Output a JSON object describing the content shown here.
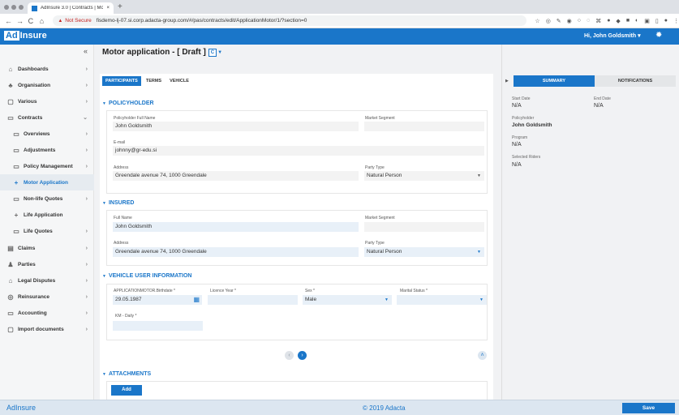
{
  "browser": {
    "tab_title": "AdInsure 3.0 | Contracts | Mo",
    "tab_close": "×",
    "new_tab": "+",
    "not_secure": "Not Secure",
    "url": "fisdemo-lj-07.si.corp.adacta-group.com/#/pas/contracts/edit/ApplicationMotor/1/?section=0"
  },
  "header": {
    "logo_box": "Ad",
    "logo_rest": "Insure",
    "user": "Hi, John Goldsmith ▾"
  },
  "sidebar": {
    "collapse": "«",
    "items": [
      {
        "label": "Dashboards",
        "icon": "dashboard-icon",
        "glyph": "⌂"
      },
      {
        "label": "Organisation",
        "icon": "organisation-icon",
        "glyph": "♣"
      },
      {
        "label": "Various",
        "icon": "various-icon",
        "glyph": "▢"
      },
      {
        "label": "Contracts",
        "icon": "folder-icon",
        "glyph": "▭"
      },
      {
        "label": "Overviews",
        "icon": "folder-icon",
        "glyph": "▭"
      },
      {
        "label": "Adjustments",
        "icon": "folder-icon",
        "glyph": "▭"
      },
      {
        "label": "Policy Management",
        "icon": "folder-icon",
        "glyph": "▭"
      },
      {
        "label": "Motor Application",
        "icon": "plus-icon",
        "glyph": "+"
      },
      {
        "label": "Non-life Quotes",
        "icon": "folder-icon",
        "glyph": "▭"
      },
      {
        "label": "Life Application",
        "icon": "plus-icon",
        "glyph": "+"
      },
      {
        "label": "Life Quotes",
        "icon": "folder-icon",
        "glyph": "▭"
      },
      {
        "label": "Claims",
        "icon": "claims-icon",
        "glyph": "▤"
      },
      {
        "label": "Parties",
        "icon": "parties-icon",
        "glyph": "♟"
      },
      {
        "label": "Legal Disputes",
        "icon": "legal-icon",
        "glyph": "⌂"
      },
      {
        "label": "Reinsurance",
        "icon": "reinsurance-icon",
        "glyph": "◎"
      },
      {
        "label": "Accounting",
        "icon": "accounting-icon",
        "glyph": "▭"
      },
      {
        "label": "Import documents",
        "icon": "import-icon",
        "glyph": "▢"
      }
    ]
  },
  "main": {
    "title": "Motor application - [ Draft ]",
    "badge": "C",
    "tabs": [
      "PARTICIPANTS",
      "TERMS",
      "VEHICLE"
    ],
    "policyholder": {
      "section": "POLICYHOLDER",
      "full_name_label": "Policyholder Full Name",
      "full_name": "John Goldsmith",
      "segment_label": "Market Segment",
      "segment": "",
      "email_label": "E-mail",
      "email": "johnny@gr-edu.si",
      "address_label": "Address",
      "address": "Greendale avenue 74, 1000 Greendale",
      "party_type_label": "Party Type",
      "party_type": "Natural Person"
    },
    "insured": {
      "section": "INSURED",
      "full_name_label": "Full Name",
      "full_name": "John Goldsmith",
      "segment_label": "Market Segment",
      "segment": "",
      "address_label": "Address",
      "address": "Greendale avenue 74, 1000 Greendale",
      "party_type_label": "Party Type",
      "party_type": "Natural Person"
    },
    "vehicle_user": {
      "section": "VEHICLE USER INFORMATION",
      "birthdate_label": "APPLICATIONMOTOR.Birthdate *",
      "birthdate": "29.05.1987",
      "licence_label": "Licence Year *",
      "licence": "",
      "sex_label": "Sex *",
      "sex": "Male",
      "marital_label": "Marital Status *",
      "marital": "",
      "km_label": "KM - Daily *",
      "km": ""
    },
    "pager_prev": "‹",
    "pager_next": "›",
    "scroll_up": "˄",
    "attachments": {
      "section": "ATTACHMENTS",
      "add": "Add"
    }
  },
  "right_panel": {
    "tab_summary": "SUMMARY",
    "tab_notifications": "NOTIFICATIONS",
    "start_date_label": "Start Date",
    "start_date": "N/A",
    "end_date_label": "End Date",
    "end_date": "N/A",
    "policyholder_label": "Policyholder",
    "policyholder": "John Goldsmith",
    "program_label": "Program",
    "program": "N/A",
    "riders_label": "Selected Riders",
    "riders": "N/A"
  },
  "footer": {
    "logo": "AdInsure",
    "copyright": "© 2019 Adacta",
    "save": "Save"
  },
  "colors": {
    "accent": "#1a76c9"
  }
}
